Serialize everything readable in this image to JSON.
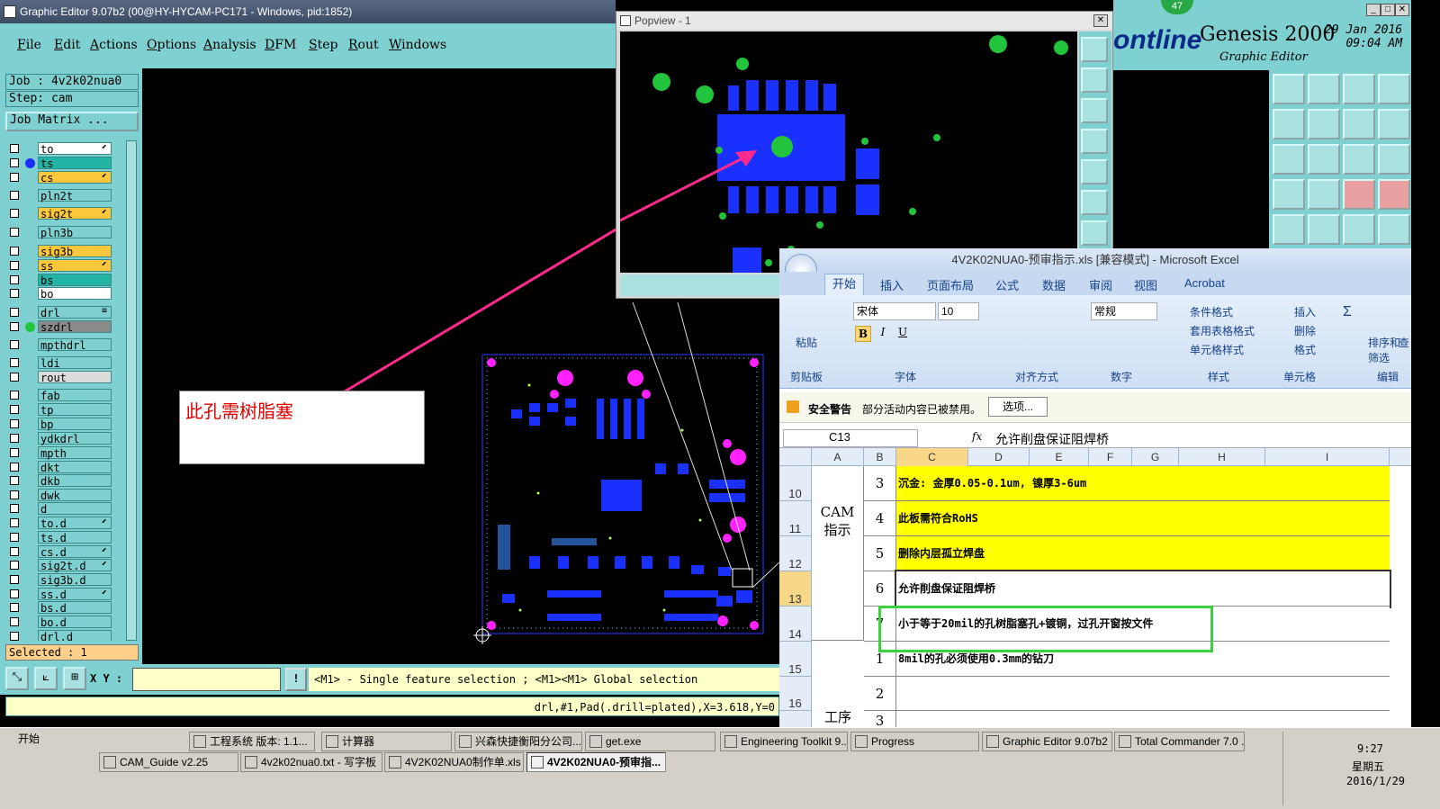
{
  "ge": {
    "title": "Graphic Editor 9.07b2 (00@HY-HYCAM-PC171 - Windows, pid:1852)",
    "menu": [
      "File",
      "Edit",
      "Actions",
      "Options",
      "Analysis",
      "DFM",
      "Step",
      "Rout",
      "Windows"
    ],
    "job": "Job : 4v2k02nua0",
    "step": "Step: cam",
    "job_matrix": "Job Matrix ...",
    "layers": [
      {
        "name": "to",
        "color": "#ffffff",
        "mark": "⬋"
      },
      {
        "name": "ts",
        "color": "#22b4a4",
        "mark": ""
      },
      {
        "name": "cs",
        "color": "#ffc83c",
        "mark": "⬋"
      },
      {
        "name": "pln2t",
        "color": "#7fd0d0",
        "mark": ""
      },
      {
        "name": "sig2t",
        "color": "#ffc83c",
        "mark": "⬋"
      },
      {
        "name": "pln3b",
        "color": "#7fd0d0",
        "mark": ""
      },
      {
        "name": "sig3b",
        "color": "#ffc83c",
        "mark": ""
      },
      {
        "name": "ss",
        "color": "#ffc83c",
        "mark": "⬋"
      },
      {
        "name": "bs",
        "color": "#22b4a4",
        "mark": ""
      },
      {
        "name": "bo",
        "color": "#ffffff",
        "mark": ""
      },
      {
        "name": "drl",
        "color": "#7fd0d0",
        "mark": "≡"
      },
      {
        "name": "szdrl",
        "color": "#8a8a8a",
        "mark": ""
      },
      {
        "name": "mpthdrl",
        "color": "#7fd0d0",
        "mark": ""
      },
      {
        "name": "ldi",
        "color": "#7fd0d0",
        "mark": ""
      },
      {
        "name": "rout",
        "color": "#dcdcdc",
        "mark": ""
      },
      {
        "name": "fab",
        "color": "#7fd0d0",
        "mark": ""
      },
      {
        "name": "tp",
        "color": "#7fd0d0",
        "mark": ""
      },
      {
        "name": "bp",
        "color": "#7fd0d0",
        "mark": ""
      },
      {
        "name": "ydkdrl",
        "color": "#7fd0d0",
        "mark": ""
      },
      {
        "name": "mpth",
        "color": "#7fd0d0",
        "mark": ""
      },
      {
        "name": "dkt",
        "color": "#7fd0d0",
        "mark": ""
      },
      {
        "name": "dkb",
        "color": "#7fd0d0",
        "mark": ""
      },
      {
        "name": "dwk",
        "color": "#7fd0d0",
        "mark": ""
      },
      {
        "name": "d",
        "color": "#7fd0d0",
        "mark": ""
      },
      {
        "name": "to.d",
        "color": "#7fd0d0",
        "mark": "⬋"
      },
      {
        "name": "ts.d",
        "color": "#7fd0d0",
        "mark": ""
      },
      {
        "name": "cs.d",
        "color": "#7fd0d0",
        "mark": "⬋"
      },
      {
        "name": "sig2t.d",
        "color": "#7fd0d0",
        "mark": "⬋"
      },
      {
        "name": "sig3b.d",
        "color": "#7fd0d0",
        "mark": ""
      },
      {
        "name": "ss.d",
        "color": "#7fd0d0",
        "mark": "⬋"
      },
      {
        "name": "bs.d",
        "color": "#7fd0d0",
        "mark": ""
      },
      {
        "name": "bo.d",
        "color": "#7fd0d0",
        "mark": ""
      },
      {
        "name": "drl.d",
        "color": "#7fd0d0",
        "mark": ""
      }
    ],
    "selected": "Selected : 1",
    "xy_label": "X Y :",
    "hint": "<M1> - Single feature selection ; <M1><M1> Global selection",
    "status": "drl,#1,Pad(.drill=plated),X=3.618,Y=0"
  },
  "popview": {
    "title": "Popview - 1"
  },
  "genesis": {
    "logo": "ontline",
    "name": "Genesis 2000",
    "sub": "Graphic Editor",
    "date": "29 Jan 2016",
    "time": "09:04 AM",
    "badge": "47"
  },
  "callout": "此孔需树脂塞",
  "excel": {
    "title": "4V2K02NUA0-预审指示.xls  [兼容模式] - Microsoft Excel",
    "tabs": [
      "开始",
      "插入",
      "页面布局",
      "公式",
      "数据",
      "审阅",
      "视图",
      "Acrobat"
    ],
    "ribbon": {
      "paste": "粘贴",
      "font": "宋体",
      "size": "10",
      "format": "常规",
      "cond": "条件格式",
      "table": "套用表格格式",
      "cellstyle": "单元格样式",
      "insert": "插入",
      "delete": "删除",
      "fmt": "格式",
      "sort": "排序和筛选",
      "find": "查",
      "groups": [
        "剪贴板",
        "字体",
        "对齐方式",
        "数字",
        "样式",
        "单元格",
        "编辑"
      ]
    },
    "warn_label": "安全警告",
    "warn_text": "部分活动内容已被禁用。",
    "warn_btn": "选项...",
    "cellref": "C13",
    "fx": "fx",
    "formula": "允许削盘保证阻焊桥",
    "cols": [
      "A",
      "B",
      "C",
      "D",
      "E",
      "F",
      "G",
      "H",
      "I"
    ],
    "rows": [
      {
        "rh": "10",
        "b": "3",
        "c": "沉金: 金厚0.05-0.1um, 镍厚3-6um",
        "fill": "#ffff00"
      },
      {
        "rh": "11",
        "b": "4",
        "c": "此板需符合RoHS",
        "fill": "#ffff00"
      },
      {
        "rh": "12",
        "b": "5",
        "c": "删除内层孤立焊盘",
        "fill": "#ffff00"
      },
      {
        "rh": "13",
        "b": "6",
        "c": "允许削盘保证阻焊桥",
        "fill": "#ffffff"
      },
      {
        "rh": "14",
        "b": "7",
        "c": "小于等于20mil的孔树脂塞孔+镀铜，过孔开窗按文件",
        "fill": "#ffffff"
      },
      {
        "rh": "15",
        "b": "1",
        "c": "8mil的孔必须使用0.3mm的钻刀",
        "fill": "#ffffff"
      },
      {
        "rh": "16",
        "b": "2",
        "c": "",
        "fill": "#ffffff"
      },
      {
        "rh": "",
        "b": "3",
        "c": "",
        "fill": "#ffffff"
      }
    ],
    "a_label1": "CAM",
    "a_label2": "指示",
    "a_label3": "工序"
  },
  "taskbar": {
    "start": "开始",
    "row1": [
      "工程系统  版本: 1.1...",
      "计算器",
      "兴森快捷衡阳分公司...",
      "get.exe",
      "Engineering Toolkit 9....",
      "Progress",
      "Graphic Editor 9.07b2 ...",
      "Total Commander 7.0 ..."
    ],
    "row2": [
      "CAM_Guide v2.25",
      "4v2k02nua0.txt - 写字板",
      "4V2K02NUA0制作单.xls ...",
      "4V2K02NUA0-预审指..."
    ],
    "time": "9:27",
    "weekday": "星期五",
    "date": "2016/1/29"
  }
}
